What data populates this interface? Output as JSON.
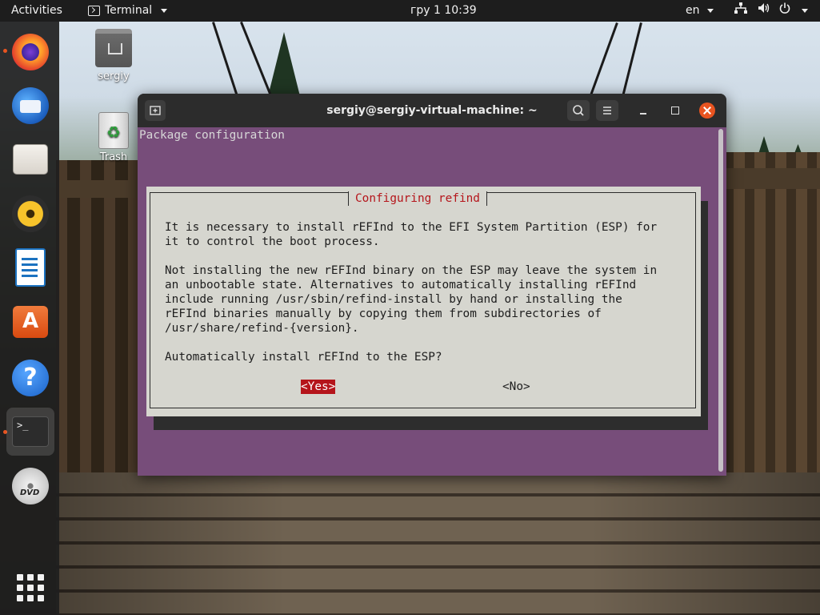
{
  "topbar": {
    "activities": "Activities",
    "app_name": "Terminal",
    "clock": "гру 1  10:39",
    "language": "en"
  },
  "dock": {
    "items": [
      {
        "name": "firefox",
        "icon": "firefox-icon"
      },
      {
        "name": "thunderbird",
        "icon": "thunderbird-icon"
      },
      {
        "name": "files",
        "icon": "files-icon"
      },
      {
        "name": "rhythmbox",
        "icon": "rhythmbox-icon"
      },
      {
        "name": "libreoffice-writer",
        "icon": "writer-icon"
      },
      {
        "name": "ubuntu-software",
        "icon": "software-icon",
        "glyph": "A"
      },
      {
        "name": "help",
        "icon": "help-icon",
        "glyph": "?"
      },
      {
        "name": "terminal",
        "icon": "terminal-icon",
        "glyph": ">_"
      },
      {
        "name": "dvd",
        "icon": "dvd-icon",
        "glyph": "DVD"
      }
    ]
  },
  "desktop": {
    "home_label": "sergiy",
    "trash_label": "Trash",
    "trash_glyph": "♻"
  },
  "window": {
    "title": "sergiy@sergiy-virtual-machine: ~"
  },
  "terminal": {
    "header": "Package configuration",
    "dialog": {
      "title": "Configuring refind",
      "body": "It is necessary to install rEFInd to the EFI System Partition (ESP) for\nit to control the boot process.\n\nNot installing the new rEFInd binary on the ESP may leave the system in\nan unbootable state. Alternatives to automatically installing rEFInd\ninclude running /usr/sbin/refind-install by hand or installing the\nrEFInd binaries manually by copying them from subdirectories of\n/usr/share/refind-{version}.\n\nAutomatically install rEFInd to the ESP?",
      "yes_label": "<Yes>",
      "no_label": "<No>"
    }
  },
  "colors": {
    "terminal_bg": "#774d7a",
    "dialog_bg": "#d6d6cf",
    "dialog_title": "#b5151b",
    "selected_button_bg": "#b5151b",
    "accent": "#e95420"
  }
}
